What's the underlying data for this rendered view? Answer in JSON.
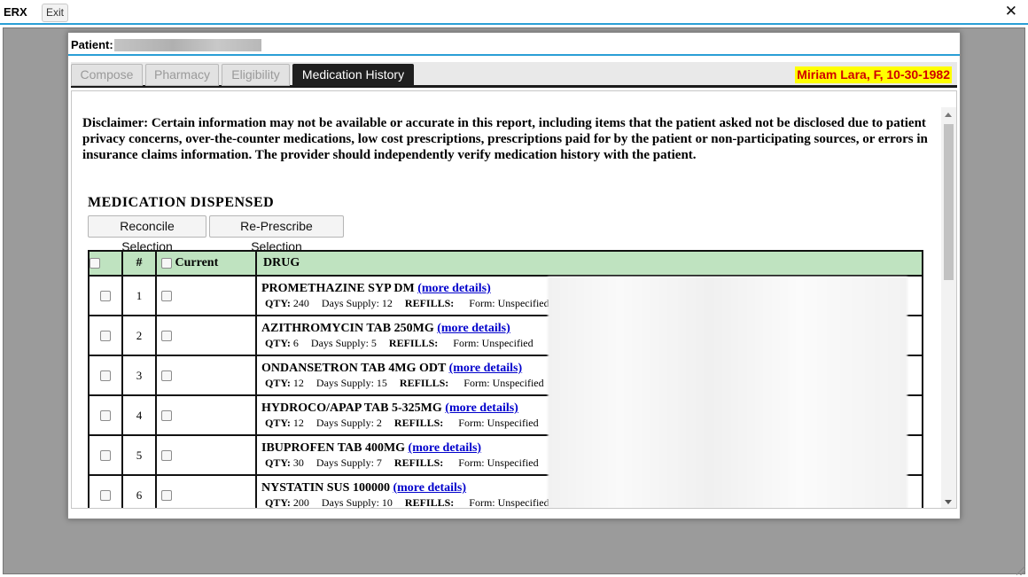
{
  "window": {
    "title": "ERX",
    "exit_label": "Exit",
    "close_glyph": "✕"
  },
  "patient": {
    "label": "Patient:",
    "display_name": "Miriam Lara, F, 10-30-1982"
  },
  "tabs": [
    {
      "label": "Compose",
      "active": false
    },
    {
      "label": "Pharmacy",
      "active": false
    },
    {
      "label": "Eligibility",
      "active": false
    },
    {
      "label": "Medication History",
      "active": true
    }
  ],
  "disclaimer": "Disclaimer: Certain information may not be available or accurate in this report, including items that the patient asked not be disclosed due to patient privacy concerns, over-the-counter medications, low cost prescriptions, prescriptions paid for by the patient or non-participating sources, or errors in insurance claims information. The provider should independently verify medication history with the patient.",
  "section_title": "MEDICATION DISPENSED",
  "buttons": {
    "reconcile": "Reconcile Selection",
    "represcribe": "Re-Prescribe Selection"
  },
  "table": {
    "headers": {
      "num": "#",
      "current": "Current",
      "drug": "DRUG"
    },
    "more_details_label": "(more details)",
    "qty_label": "QTY:",
    "days_label": "Days Supply:",
    "refills_label": "REFILLS:",
    "form_label": "Form:",
    "rows": [
      {
        "num": "1",
        "drug": "PROMETHAZINE SYP DM",
        "qty": "240",
        "days": "12",
        "refills": "",
        "form": "Unspecified"
      },
      {
        "num": "2",
        "drug": "AZITHROMYCIN TAB 250MG",
        "qty": "6",
        "days": "5",
        "refills": "",
        "form": "Unspecified"
      },
      {
        "num": "3",
        "drug": "ONDANSETRON TAB 4MG ODT",
        "qty": "12",
        "days": "15",
        "refills": "",
        "form": "Unspecified"
      },
      {
        "num": "4",
        "drug": "HYDROCO/APAP TAB 5-325MG",
        "qty": "12",
        "days": "2",
        "refills": "",
        "form": "Unspecified"
      },
      {
        "num": "5",
        "drug": "IBUPROFEN TAB 400MG",
        "qty": "30",
        "days": "7",
        "refills": "",
        "form": "Unspecified"
      },
      {
        "num": "6",
        "drug": "NYSTATIN SUS 100000",
        "qty": "200",
        "days": "10",
        "refills": "",
        "form": "Unspecified"
      }
    ]
  },
  "colors": {
    "accent": "#2a9fd6",
    "table_header": "#bfe3c0",
    "patient_highlight_bg": "#ffff00",
    "patient_highlight_text": "#d00000",
    "link": "#0000cc"
  }
}
